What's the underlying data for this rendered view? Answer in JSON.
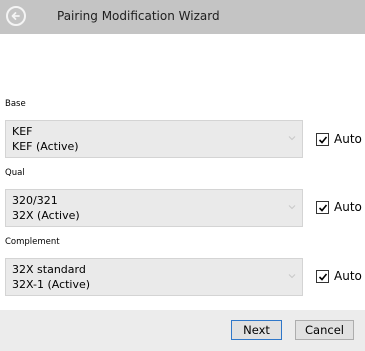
{
  "window": {
    "title": "Pairing Modification Wizard",
    "back_icon": "back-arrow-icon"
  },
  "fields": [
    {
      "label": "Base",
      "line1": "KEF",
      "line2": "KEF (Active)",
      "auto_label": "Auto",
      "auto_checked": true
    },
    {
      "label": "Qual",
      "line1": "320/321",
      "line2": "32X (Active)",
      "auto_label": "Auto",
      "auto_checked": true
    },
    {
      "label": "Complement",
      "line1": "32X standard",
      "line2": "32X-1 (Active)",
      "auto_label": "Auto",
      "auto_checked": true
    }
  ],
  "footer": {
    "next_label": "Next",
    "cancel_label": "Cancel"
  },
  "colors": {
    "titlebar": "#c4c4c4",
    "combo_bg": "#eaeaea",
    "footer_bg": "#ececec",
    "focus_border": "#2f77c9"
  }
}
